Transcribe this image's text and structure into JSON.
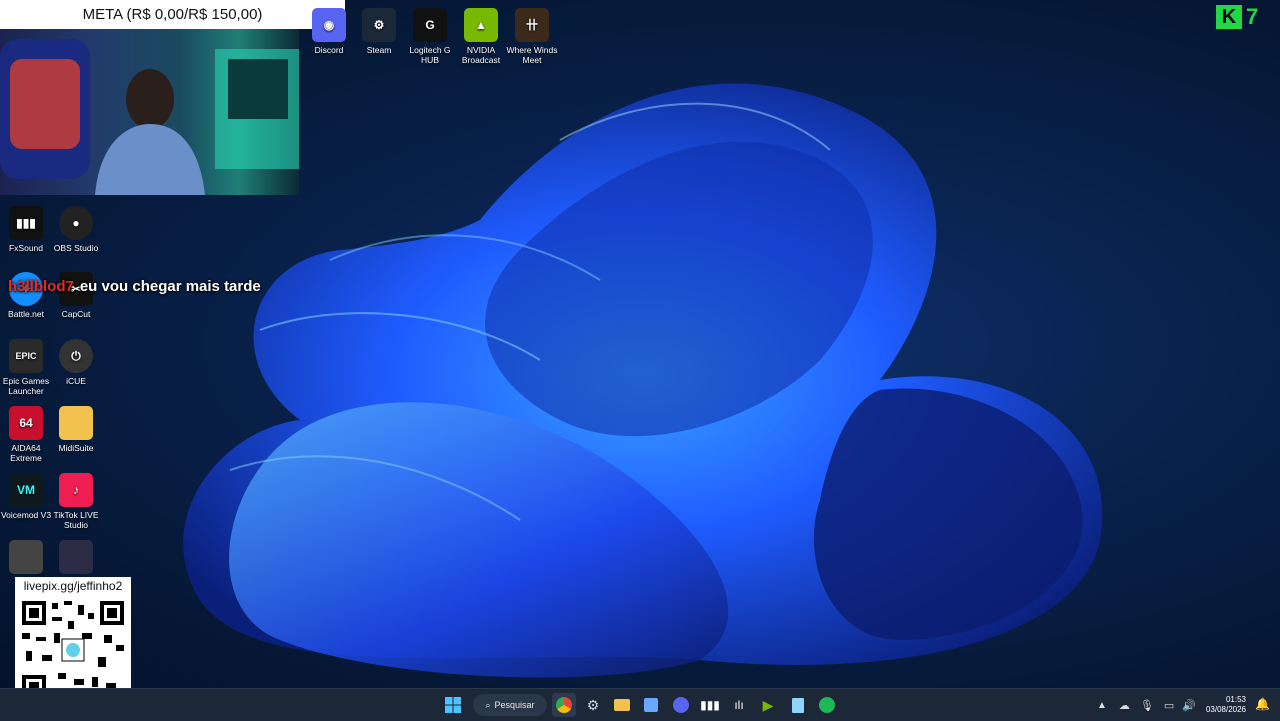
{
  "overlay": {
    "meta_text": "META (R$ 0,00/R$ 150,00)",
    "chat_user": "h3llblod7",
    "chat_message": "eu vou chegar mais tarde",
    "qr_url": "livepix.gg/jeffinho2",
    "brand_k": "K",
    "brand_7": "7"
  },
  "desktop_icons_top": [
    {
      "label": "Discord",
      "icon": "discord-icon",
      "color": "#5865F2"
    },
    {
      "label": "Steam",
      "icon": "steam-icon",
      "color": "#1b2838"
    },
    {
      "label": "Logitech G HUB",
      "icon": "logitech-icon",
      "color": "#111111"
    },
    {
      "label": "NVIDIA Broadcast",
      "icon": "nvidia-icon",
      "color": "#76B900"
    },
    {
      "label": "Where Winds Meet",
      "icon": "game-icon",
      "color": "#3b2a1a"
    }
  ],
  "desktop_icons_left": [
    {
      "label": "FxSound",
      "icon": "fxsound-icon",
      "color": "#111111"
    },
    {
      "label": "OBS Studio",
      "icon": "obs-icon",
      "color": "#222222"
    },
    {
      "label": "Battle.net",
      "icon": "battlenet-icon",
      "color": "#148EFF"
    },
    {
      "label": "CapCut",
      "icon": "capcut-icon",
      "color": "#111111"
    },
    {
      "label": "Epic Games Launcher",
      "icon": "epic-icon",
      "color": "#2a2a2a"
    },
    {
      "label": "iCUE",
      "icon": "icue-icon",
      "color": "#333333"
    },
    {
      "label": "AIDA64 Extreme",
      "icon": "aida64-icon",
      "color": "#c8102e"
    },
    {
      "label": "MidiSuite",
      "icon": "folder-icon",
      "color": "#f2c14e"
    },
    {
      "label": "Voicemod V3",
      "icon": "voicemod-icon",
      "color": "#0f1a1f"
    },
    {
      "label": "TikTok LIVE Studio",
      "icon": "tiktok-icon",
      "color": "#ee1d52"
    }
  ],
  "taskbar": {
    "search_label": "Pesquisar",
    "time": "01:53",
    "date": "03/08/2026",
    "apps": [
      "start-icon",
      "chrome-icon",
      "steam-icon",
      "file-explorer-icon",
      "store-icon",
      "discord-icon",
      "piano-icon",
      "fxsound-icon",
      "nvidia-icon",
      "notepad-icon",
      "spotify-icon"
    ]
  },
  "colors": {
    "accent": "#1f5cff",
    "taskbar": "#1c2738",
    "chat_user": "#e32b2b"
  }
}
